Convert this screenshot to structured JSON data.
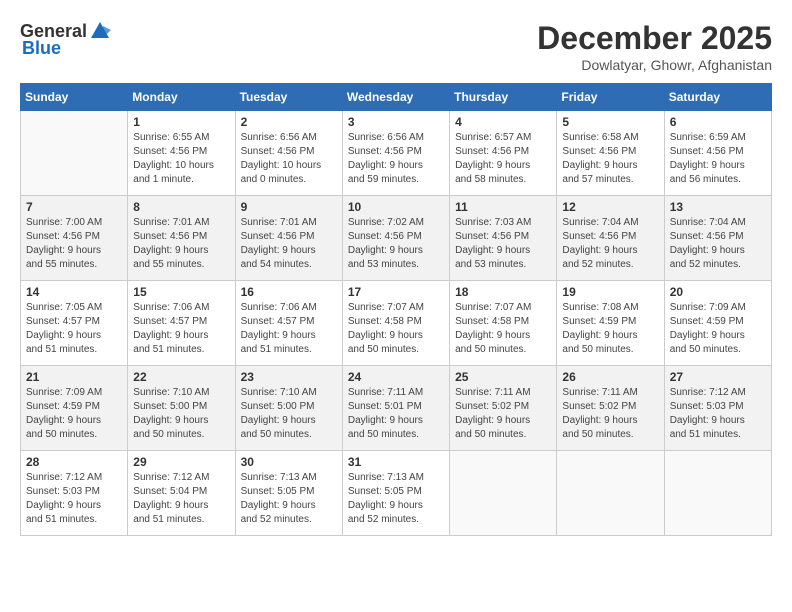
{
  "header": {
    "logo_general": "General",
    "logo_blue": "Blue",
    "title": "December 2025",
    "subtitle": "Dowlatyar, Ghowr, Afghanistan"
  },
  "calendar": {
    "days_of_week": [
      "Sunday",
      "Monday",
      "Tuesday",
      "Wednesday",
      "Thursday",
      "Friday",
      "Saturday"
    ],
    "weeks": [
      [
        {
          "day": "",
          "info": ""
        },
        {
          "day": "1",
          "info": "Sunrise: 6:55 AM\nSunset: 4:56 PM\nDaylight: 10 hours\nand 1 minute."
        },
        {
          "day": "2",
          "info": "Sunrise: 6:56 AM\nSunset: 4:56 PM\nDaylight: 10 hours\nand 0 minutes."
        },
        {
          "day": "3",
          "info": "Sunrise: 6:56 AM\nSunset: 4:56 PM\nDaylight: 9 hours\nand 59 minutes."
        },
        {
          "day": "4",
          "info": "Sunrise: 6:57 AM\nSunset: 4:56 PM\nDaylight: 9 hours\nand 58 minutes."
        },
        {
          "day": "5",
          "info": "Sunrise: 6:58 AM\nSunset: 4:56 PM\nDaylight: 9 hours\nand 57 minutes."
        },
        {
          "day": "6",
          "info": "Sunrise: 6:59 AM\nSunset: 4:56 PM\nDaylight: 9 hours\nand 56 minutes."
        }
      ],
      [
        {
          "day": "7",
          "info": "Sunrise: 7:00 AM\nSunset: 4:56 PM\nDaylight: 9 hours\nand 55 minutes."
        },
        {
          "day": "8",
          "info": "Sunrise: 7:01 AM\nSunset: 4:56 PM\nDaylight: 9 hours\nand 55 minutes."
        },
        {
          "day": "9",
          "info": "Sunrise: 7:01 AM\nSunset: 4:56 PM\nDaylight: 9 hours\nand 54 minutes."
        },
        {
          "day": "10",
          "info": "Sunrise: 7:02 AM\nSunset: 4:56 PM\nDaylight: 9 hours\nand 53 minutes."
        },
        {
          "day": "11",
          "info": "Sunrise: 7:03 AM\nSunset: 4:56 PM\nDaylight: 9 hours\nand 53 minutes."
        },
        {
          "day": "12",
          "info": "Sunrise: 7:04 AM\nSunset: 4:56 PM\nDaylight: 9 hours\nand 52 minutes."
        },
        {
          "day": "13",
          "info": "Sunrise: 7:04 AM\nSunset: 4:56 PM\nDaylight: 9 hours\nand 52 minutes."
        }
      ],
      [
        {
          "day": "14",
          "info": "Sunrise: 7:05 AM\nSunset: 4:57 PM\nDaylight: 9 hours\nand 51 minutes."
        },
        {
          "day": "15",
          "info": "Sunrise: 7:06 AM\nSunset: 4:57 PM\nDaylight: 9 hours\nand 51 minutes."
        },
        {
          "day": "16",
          "info": "Sunrise: 7:06 AM\nSunset: 4:57 PM\nDaylight: 9 hours\nand 51 minutes."
        },
        {
          "day": "17",
          "info": "Sunrise: 7:07 AM\nSunset: 4:58 PM\nDaylight: 9 hours\nand 50 minutes."
        },
        {
          "day": "18",
          "info": "Sunrise: 7:07 AM\nSunset: 4:58 PM\nDaylight: 9 hours\nand 50 minutes."
        },
        {
          "day": "19",
          "info": "Sunrise: 7:08 AM\nSunset: 4:59 PM\nDaylight: 9 hours\nand 50 minutes."
        },
        {
          "day": "20",
          "info": "Sunrise: 7:09 AM\nSunset: 4:59 PM\nDaylight: 9 hours\nand 50 minutes."
        }
      ],
      [
        {
          "day": "21",
          "info": "Sunrise: 7:09 AM\nSunset: 4:59 PM\nDaylight: 9 hours\nand 50 minutes."
        },
        {
          "day": "22",
          "info": "Sunrise: 7:10 AM\nSunset: 5:00 PM\nDaylight: 9 hours\nand 50 minutes."
        },
        {
          "day": "23",
          "info": "Sunrise: 7:10 AM\nSunset: 5:00 PM\nDaylight: 9 hours\nand 50 minutes."
        },
        {
          "day": "24",
          "info": "Sunrise: 7:11 AM\nSunset: 5:01 PM\nDaylight: 9 hours\nand 50 minutes."
        },
        {
          "day": "25",
          "info": "Sunrise: 7:11 AM\nSunset: 5:02 PM\nDaylight: 9 hours\nand 50 minutes."
        },
        {
          "day": "26",
          "info": "Sunrise: 7:11 AM\nSunset: 5:02 PM\nDaylight: 9 hours\nand 50 minutes."
        },
        {
          "day": "27",
          "info": "Sunrise: 7:12 AM\nSunset: 5:03 PM\nDaylight: 9 hours\nand 51 minutes."
        }
      ],
      [
        {
          "day": "28",
          "info": "Sunrise: 7:12 AM\nSunset: 5:03 PM\nDaylight: 9 hours\nand 51 minutes."
        },
        {
          "day": "29",
          "info": "Sunrise: 7:12 AM\nSunset: 5:04 PM\nDaylight: 9 hours\nand 51 minutes."
        },
        {
          "day": "30",
          "info": "Sunrise: 7:13 AM\nSunset: 5:05 PM\nDaylight: 9 hours\nand 52 minutes."
        },
        {
          "day": "31",
          "info": "Sunrise: 7:13 AM\nSunset: 5:05 PM\nDaylight: 9 hours\nand 52 minutes."
        },
        {
          "day": "",
          "info": ""
        },
        {
          "day": "",
          "info": ""
        },
        {
          "day": "",
          "info": ""
        }
      ]
    ]
  }
}
